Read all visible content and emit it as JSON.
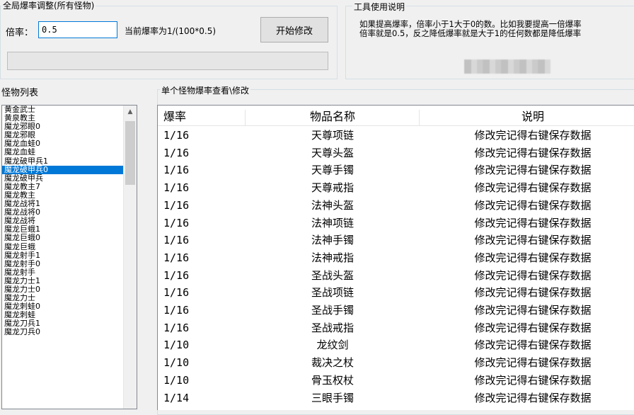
{
  "global": {
    "title": "全局爆率调整(所有怪物)",
    "rate_label": "倍率：",
    "rate_value": "0.5",
    "current_rate": "当前爆率为1/(100*0.5)",
    "start_button": "开始修改"
  },
  "help": {
    "title": "工具使用说明",
    "text": "如果提高爆率，倍率小于1大于0的数。比如我要提高一倍爆率\n倍率就是0.5，反之降低爆率就是大于1的任何数都是降低爆率"
  },
  "monsters": {
    "title": "怪物列表",
    "selected_index": 7,
    "items": [
      "黄金武士",
      "黄泉教主",
      "魔龙邪眼0",
      "魔龙邪眼",
      "魔龙血蛙0",
      "魔龙血蛙",
      "魔龙破甲兵1",
      "魔龙破甲兵0",
      "魔龙破甲兵",
      "魔龙教主7",
      "魔龙教主",
      "魔龙战将1",
      "魔龙战将0",
      "魔龙战将",
      "魔龙巨蛾1",
      "魔龙巨蛾0",
      "魔龙巨蛾",
      "魔龙射手1",
      "魔龙射手0",
      "魔龙射手",
      "魔龙力士1",
      "魔龙力士0",
      "魔龙力士",
      "魔龙刺蛙0",
      "魔龙刺蛙",
      "魔龙刀兵1",
      "魔龙刀兵0"
    ]
  },
  "detail": {
    "title": "单个怪物爆率查看\\修改",
    "columns": [
      "爆率",
      "物品名称",
      "说明"
    ],
    "rows": [
      [
        "1/16",
        "天尊项链",
        "修改完记得右键保存数据"
      ],
      [
        "1/16",
        "天尊头盔",
        "修改完记得右键保存数据"
      ],
      [
        "1/16",
        "天尊手镯",
        "修改完记得右键保存数据"
      ],
      [
        "1/16",
        "天尊戒指",
        "修改完记得右键保存数据"
      ],
      [
        "1/16",
        "法神头盔",
        "修改完记得右键保存数据"
      ],
      [
        "1/16",
        "法神项链",
        "修改完记得右键保存数据"
      ],
      [
        "1/16",
        "法神手镯",
        "修改完记得右键保存数据"
      ],
      [
        "1/16",
        "法神戒指",
        "修改完记得右键保存数据"
      ],
      [
        "1/16",
        "圣战头盔",
        "修改完记得右键保存数据"
      ],
      [
        "1/16",
        "圣战项链",
        "修改完记得右键保存数据"
      ],
      [
        "1/16",
        "圣战手镯",
        "修改完记得右键保存数据"
      ],
      [
        "1/16",
        "圣战戒指",
        "修改完记得右键保存数据"
      ],
      [
        "1/10",
        "龙纹剑",
        "修改完记得右键保存数据"
      ],
      [
        "1/10",
        "裁决之杖",
        "修改完记得右键保存数据"
      ],
      [
        "1/10",
        "骨玉权杖",
        "修改完记得右键保存数据"
      ],
      [
        "1/14",
        "三眼手镯",
        "修改完记得右键保存数据"
      ]
    ]
  }
}
